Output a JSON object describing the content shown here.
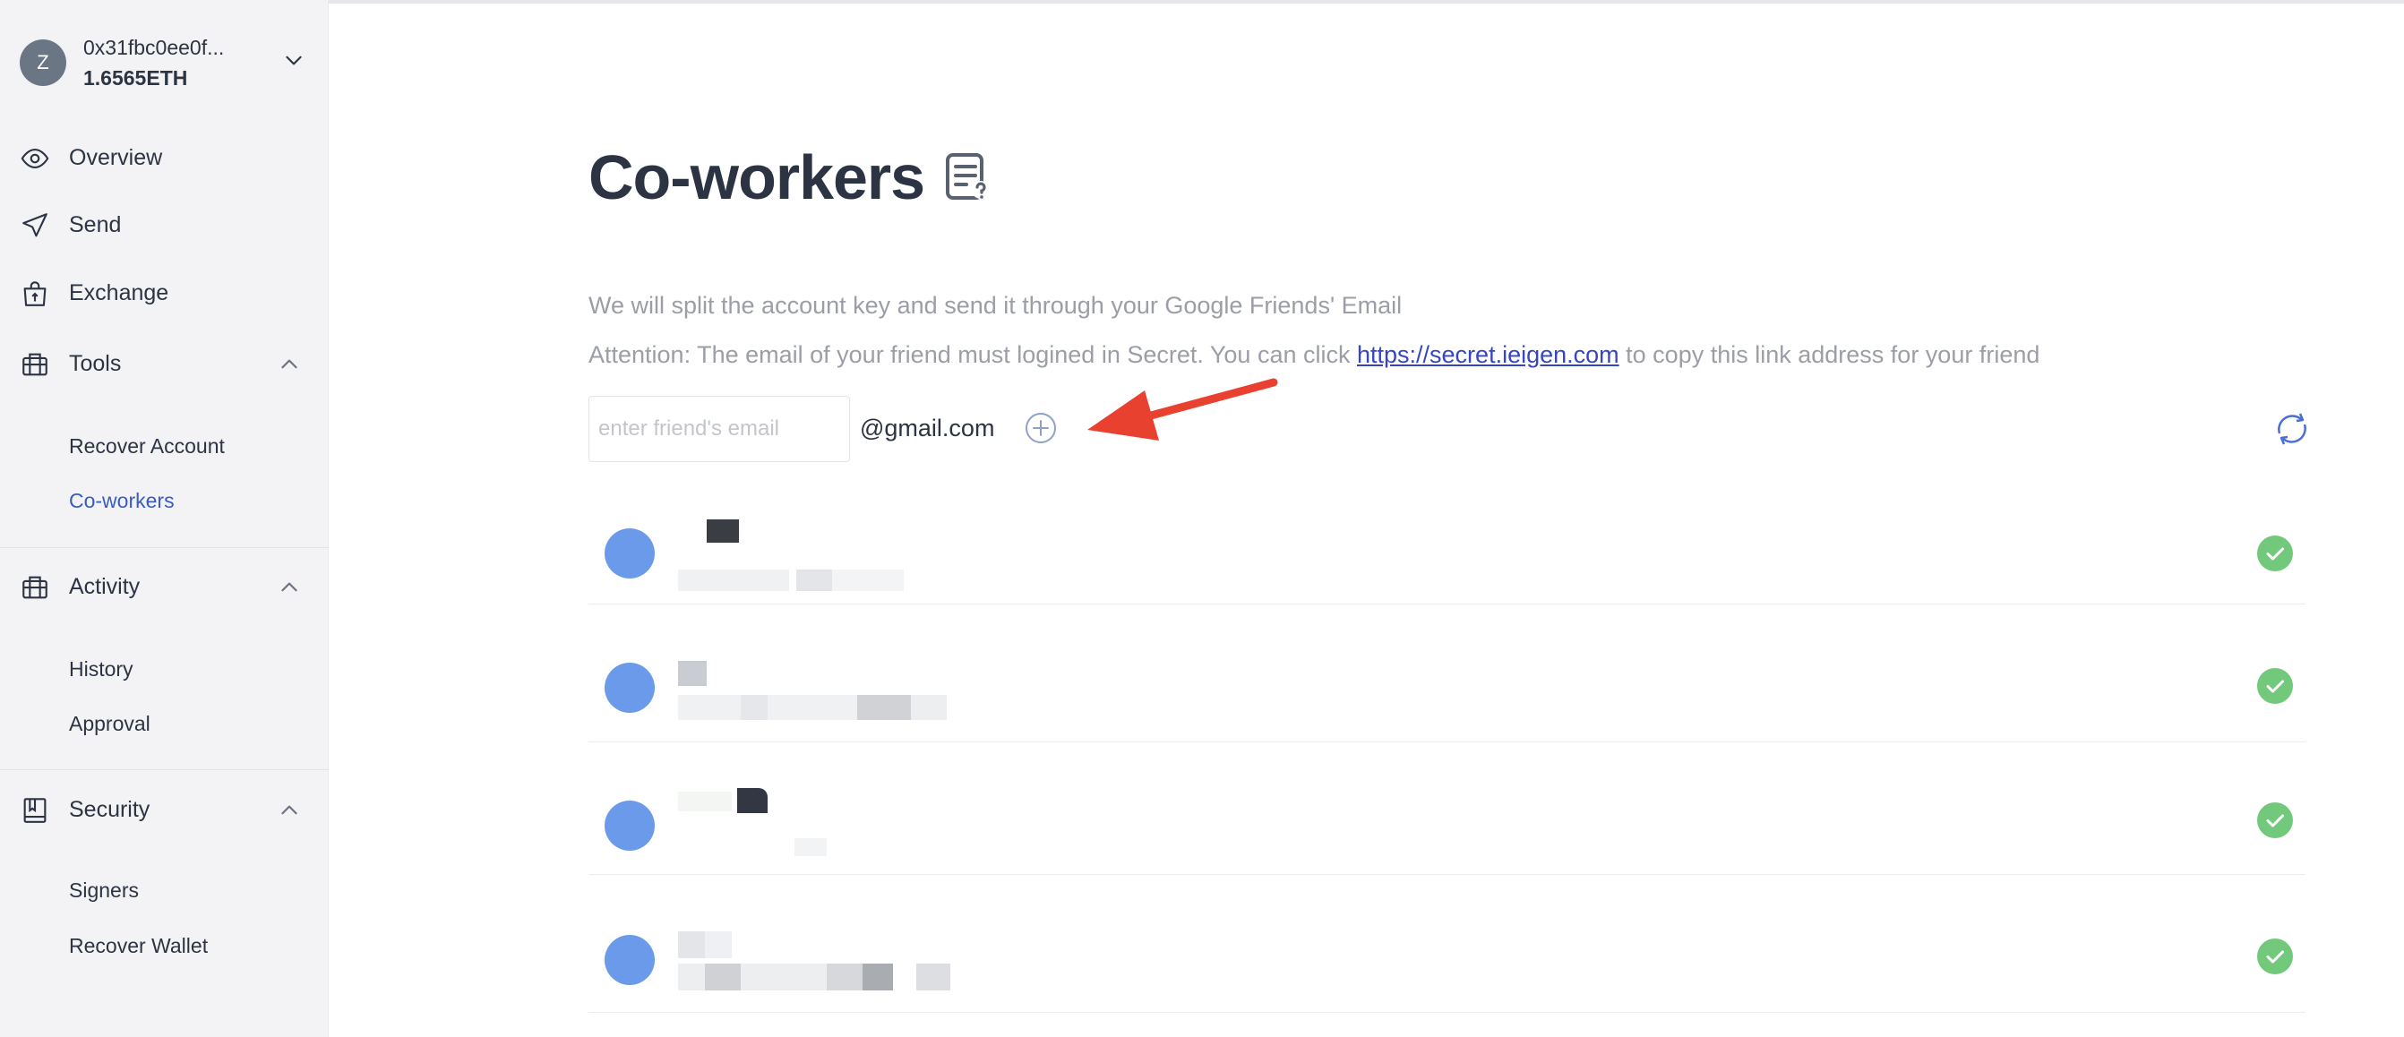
{
  "account": {
    "avatar_letter": "Z",
    "address": "0x31fbc0ee0f...",
    "balance": "1.6565ETH"
  },
  "sidebar": {
    "overview": "Overview",
    "send": "Send",
    "exchange": "Exchange",
    "tools": {
      "label": "Tools",
      "items": [
        "Recover Account",
        "Co-workers"
      ]
    },
    "activity": {
      "label": "Activity",
      "items": [
        "History",
        "Approval"
      ]
    },
    "security": {
      "label": "Security",
      "items": [
        "Signers",
        "Recover Wallet"
      ]
    },
    "active_item": "Co-workers"
  },
  "main": {
    "title": "Co-workers",
    "desc_line1": "We will split the account key and send it through your Google Friends' Email",
    "desc_line2_before": "Attention: The email of your friend must logined in Secret. You can click",
    "desc_link": "https://secret.ieigen.com",
    "desc_line2_after": "to copy this link address for your friend",
    "email_placeholder": "enter friend's email",
    "email_value": "",
    "email_suffix": "@gmail.com"
  },
  "coworkers": [
    {
      "status": "confirmed"
    },
    {
      "status": "confirmed"
    },
    {
      "status": "confirmed"
    },
    {
      "status": "confirmed"
    }
  ],
  "colors": {
    "accent": "#3b5bc4",
    "avatar_dot": "#6c9aeb",
    "check": "#73c97b",
    "annotation_arrow": "#e8412f"
  },
  "icons": {
    "title_icon": "document-question-icon",
    "add": "plus-circle-icon",
    "refresh": "refresh-icon",
    "status": "check-circle-icon"
  }
}
